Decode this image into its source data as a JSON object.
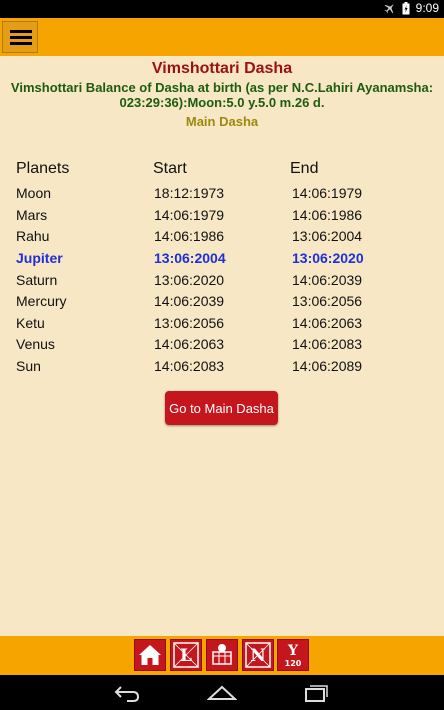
{
  "status": {
    "time": "9:09"
  },
  "header": {
    "title": "Vimshottari Dasha",
    "balance": "Vimshottari Balance of Dasha at birth (as per N.C.Lahiri Ayanamsha: 023:29:36):Moon:5.0 y.5.0 m.26 d.",
    "subtitle": "Main Dasha"
  },
  "table": {
    "headers": {
      "planet": "Planets",
      "start": "Start",
      "end": "End"
    },
    "rows": [
      {
        "planet": "Moon",
        "start": "18:12:1973",
        "end": "14:06:1979"
      },
      {
        "planet": "Mars",
        "start": "14:06:1979",
        "end": "14:06:1986"
      },
      {
        "planet": "Rahu",
        "start": "14:06:1986",
        "end": "13:06:2004"
      },
      {
        "planet": "Jupiter",
        "start": "13:06:2004",
        "end": "13:06:2020"
      },
      {
        "planet": "Saturn",
        "start": "13:06:2020",
        "end": "14:06:2039"
      },
      {
        "planet": "Mercury",
        "start": "14:06:2039",
        "end": "13:06:2056"
      },
      {
        "planet": "Ketu",
        "start": "13:06:2056",
        "end": "14:06:2063"
      },
      {
        "planet": "Venus",
        "start": "14:06:2063",
        "end": "14:06:2083"
      },
      {
        "planet": "Sun",
        "start": "14:06:2083",
        "end": "14:06:2089"
      }
    ]
  },
  "buttons": {
    "go_main_dasha": "Go to Main Dasha"
  },
  "toolbar": [
    {
      "icon": "home-icon"
    },
    {
      "icon": "lagna-chart-icon",
      "glyph": "L"
    },
    {
      "icon": "panchang-icon"
    },
    {
      "icon": "navamsa-chart-icon",
      "glyph": "N"
    },
    {
      "icon": "dasha-years-icon",
      "glyph": "Y",
      "sub": "120"
    }
  ],
  "colors": {
    "background": "#f7e7c4",
    "bar": "#f6a400",
    "title": "#9b1111",
    "balance": "#1d5c10",
    "subtitle": "#9a8a0c",
    "highlight": "#1f2fd8",
    "button": "#c4161c"
  }
}
